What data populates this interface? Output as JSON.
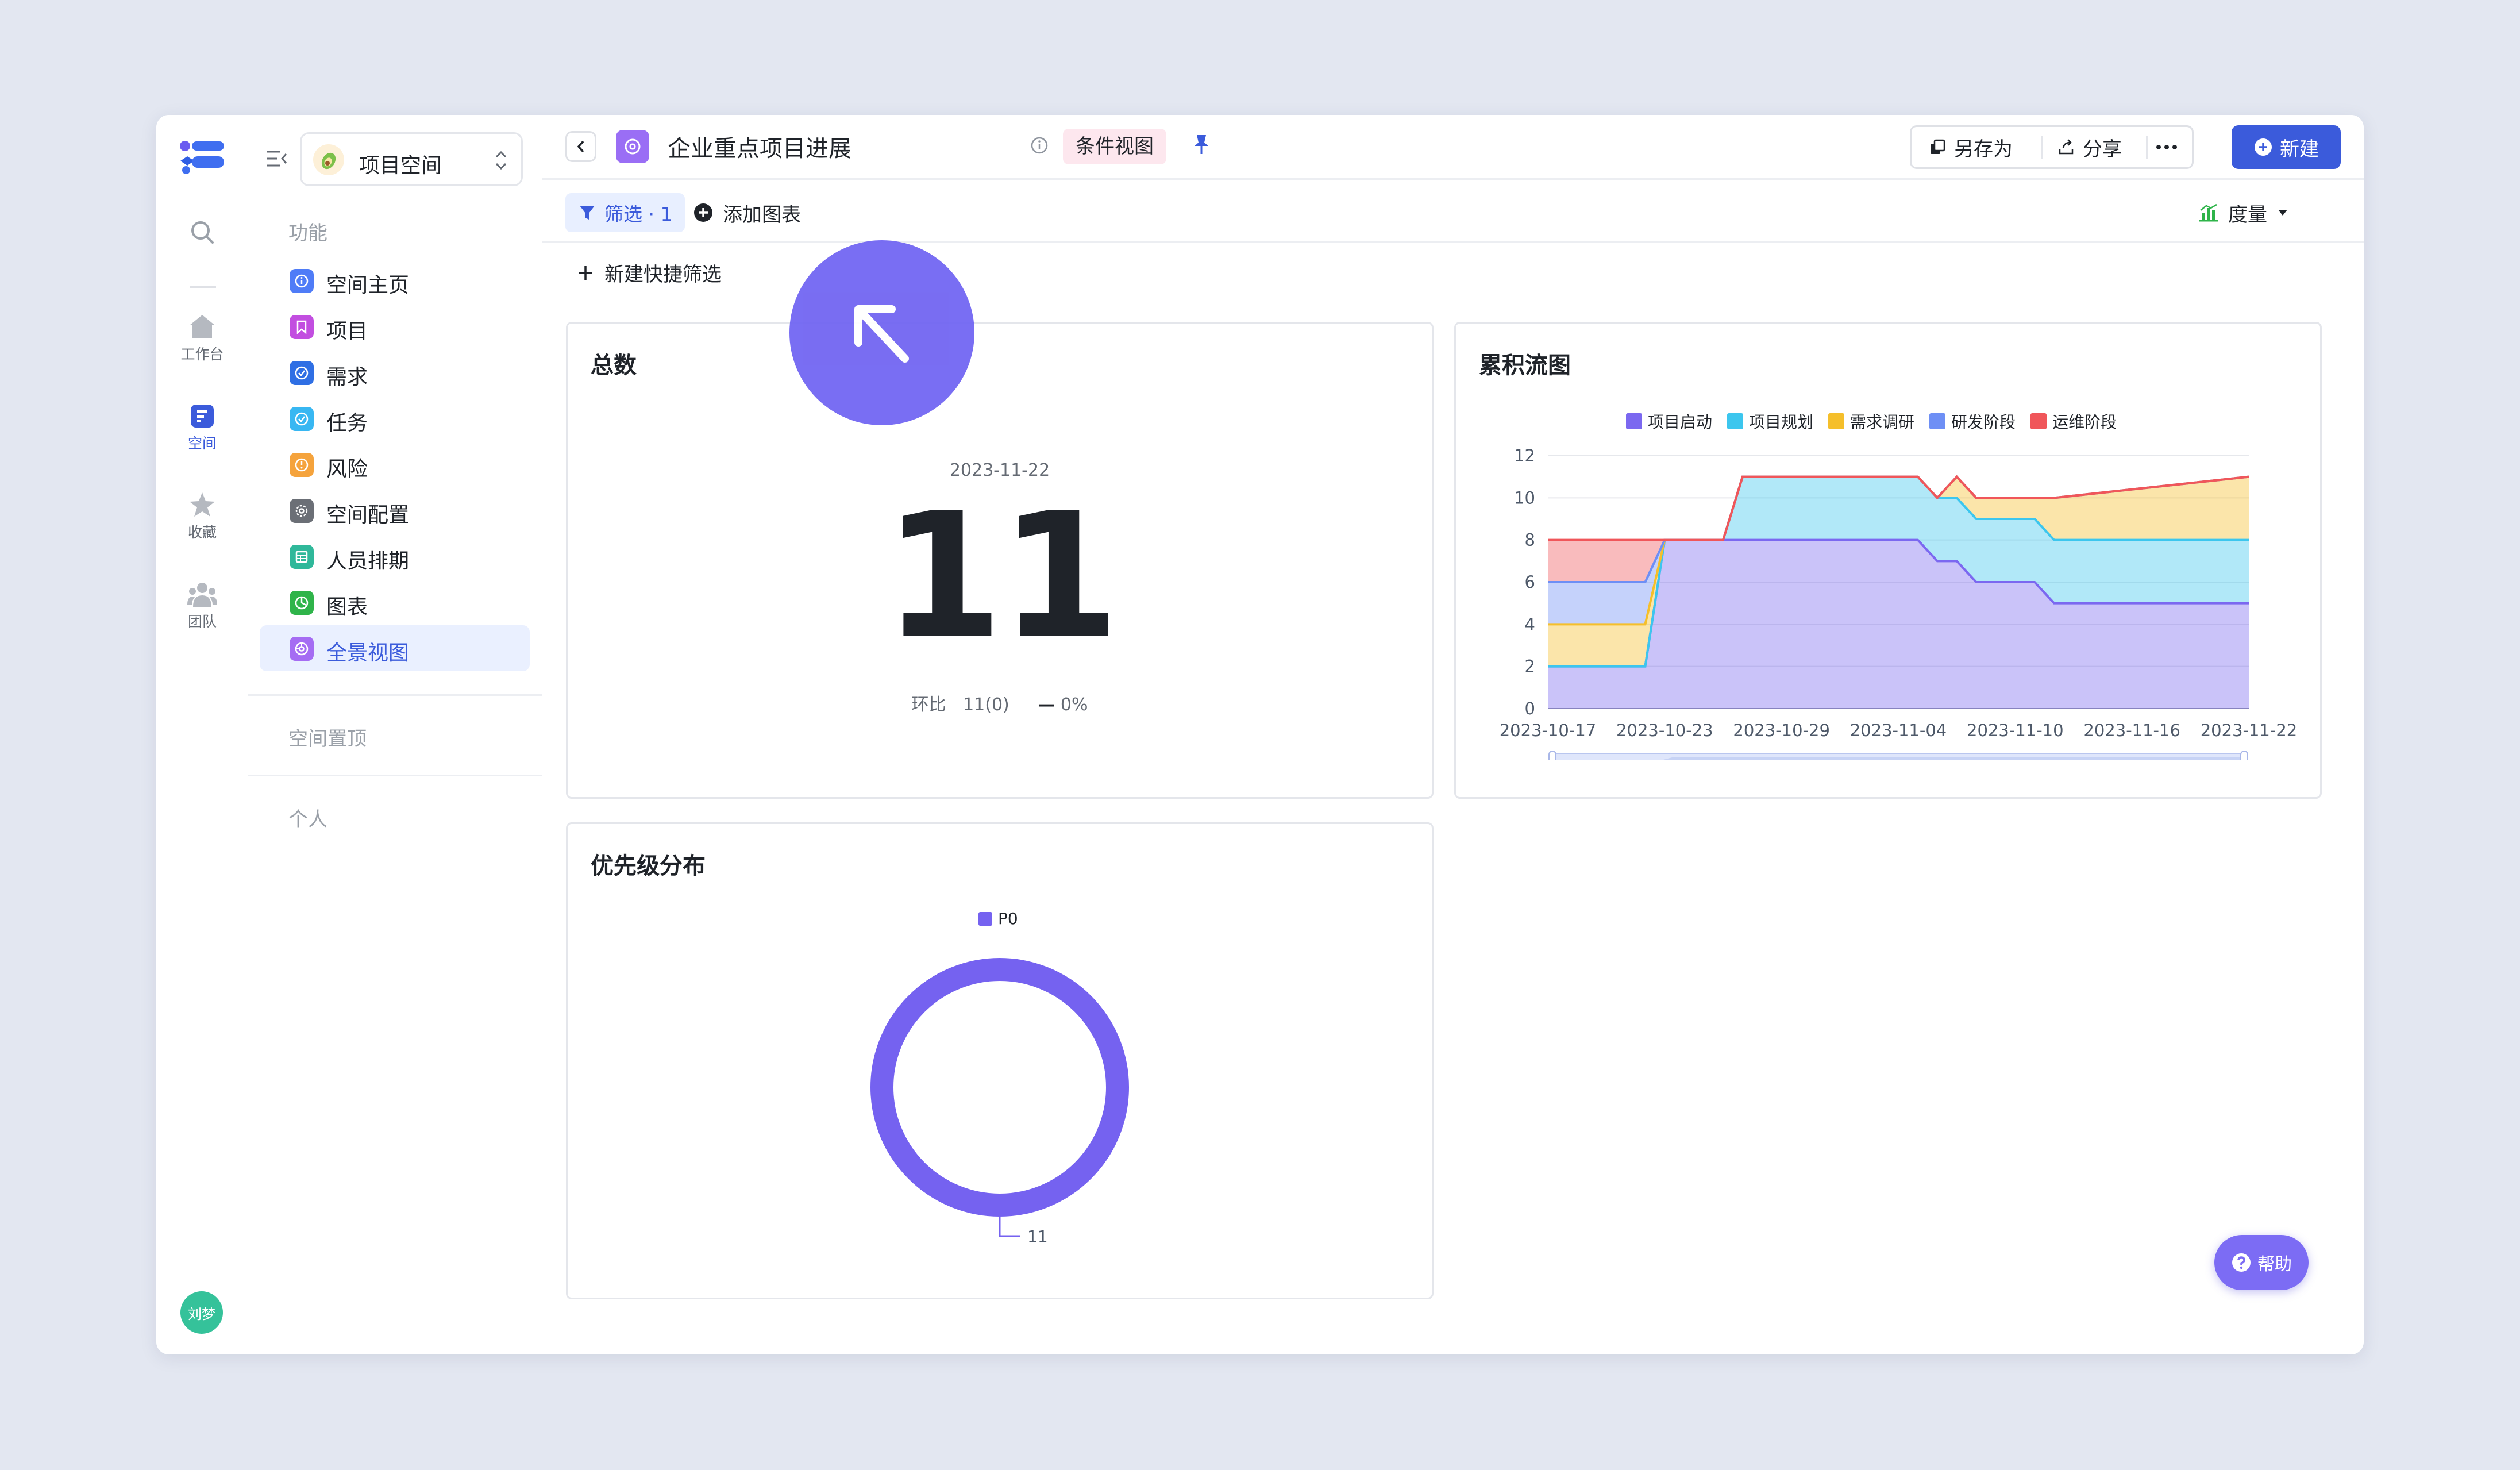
{
  "rail": {
    "items": [
      {
        "label": "工作台",
        "icon": "home-icon"
      },
      {
        "label": "空间",
        "icon": "space-icon"
      },
      {
        "label": "收藏",
        "icon": "star-icon"
      },
      {
        "label": "团队",
        "icon": "team-icon"
      }
    ],
    "avatar": "刘梦"
  },
  "sidebar": {
    "space_name": "项目空间",
    "section_functions": "功能",
    "items": [
      {
        "label": "空间主页",
        "color": "#4f7cf7"
      },
      {
        "label": "项目",
        "color": "#c24ee0"
      },
      {
        "label": "需求",
        "color": "#2f6fe4"
      },
      {
        "label": "任务",
        "color": "#38b7f2"
      },
      {
        "label": "风险",
        "color": "#f5a33c"
      },
      {
        "label": "空间配置",
        "color": "#6b6f76"
      },
      {
        "label": "人员排期",
        "color": "#2fb89a"
      },
      {
        "label": "图表",
        "color": "#2fb44a"
      },
      {
        "label": "全景视图",
        "color": "#a56cf3"
      }
    ],
    "section_pinned": "空间置顶",
    "section_personal": "个人"
  },
  "header": {
    "title": "企业重点项目进展",
    "tag": "条件视图",
    "save_as": "另存为",
    "share": "分享",
    "new": "新建"
  },
  "toolbar": {
    "filter": "筛选 · 1",
    "add_chart": "添加图表",
    "measure": "度量"
  },
  "quick_filter": "新建快捷筛选",
  "total_card": {
    "title": "总数",
    "date": "2023-11-22",
    "value": "11",
    "ratio_label": "环比",
    "ratio_value": "11(0)",
    "ratio_change": "0%"
  },
  "priority_card": {
    "title": "优先级分布",
    "legend": "P0",
    "label": "11"
  },
  "flow_card": {
    "title": "累积流图"
  },
  "help": "帮助",
  "chart_data": [
    {
      "type": "area",
      "title": "累积流图",
      "x_ticks": [
        "2023-10-17",
        "2023-10-23",
        "2023-10-29",
        "2023-11-04",
        "2023-11-10",
        "2023-11-16",
        "2023-11-22"
      ],
      "ylim": [
        0,
        12
      ],
      "y_ticks": [
        0,
        2,
        4,
        6,
        8,
        10,
        12
      ],
      "stacked": true,
      "legend_position": "top",
      "grid": true,
      "x": [
        "2023-10-17",
        "2023-10-22",
        "2023-10-23",
        "2023-10-26",
        "2023-10-27",
        "2023-11-05",
        "2023-11-06",
        "2023-11-07",
        "2023-11-08",
        "2023-11-11",
        "2023-11-12",
        "2023-11-22"
      ],
      "series": [
        {
          "name": "项目启动",
          "color": "#7b68f0",
          "values": [
            2,
            2,
            8,
            8,
            8,
            8,
            7,
            7,
            6,
            6,
            5,
            5
          ]
        },
        {
          "name": "项目规划",
          "color": "#3cc6ee",
          "values": [
            0,
            0,
            0,
            0,
            3,
            3,
            3,
            3,
            3,
            3,
            3,
            3
          ]
        },
        {
          "name": "需求调研",
          "color": "#f5bf2b",
          "values": [
            2,
            2,
            0,
            0,
            0,
            0,
            0,
            1,
            1,
            1,
            2,
            3
          ]
        },
        {
          "name": "研发阶段",
          "color": "#6e8ff5",
          "values": [
            2,
            2,
            0,
            0,
            0,
            0,
            0,
            0,
            0,
            0,
            0,
            0
          ]
        },
        {
          "name": "运维阶段",
          "color": "#f0565a",
          "values": [
            2,
            2,
            0,
            0,
            0,
            0,
            0,
            0,
            0,
            0,
            0,
            0
          ]
        }
      ]
    },
    {
      "type": "pie",
      "title": "优先级分布",
      "categories": [
        "P0"
      ],
      "values": [
        11
      ],
      "colors": [
        "#7562f0"
      ]
    }
  ]
}
